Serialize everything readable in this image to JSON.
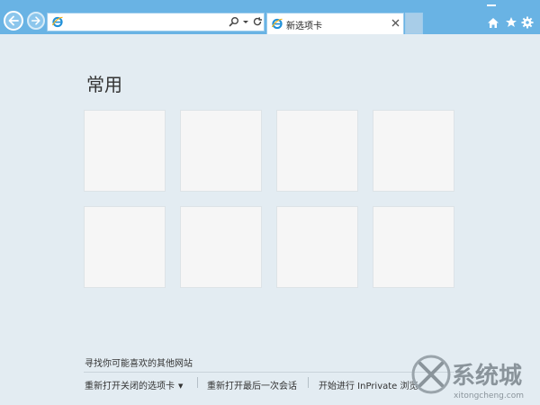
{
  "browser": {
    "address": {
      "value": "",
      "placeholder": ""
    },
    "tab": {
      "title": "新选项卡"
    }
  },
  "content": {
    "section_title": "常用",
    "tile_count": 8,
    "find_sites_link": "寻找你可能喜欢的其他网站",
    "bottom_links": {
      "reopen_closed_tabs": "重新打开关闭的选项卡",
      "reopen_last_session": "重新打开最后一次会话",
      "start_inprivate": "开始进行 InPrivate 浏览"
    }
  },
  "watermark": {
    "brand": "系统城",
    "domain": "xitongcheng.com"
  },
  "icons": [
    "back-arrow-icon",
    "forward-arrow-icon",
    "ie-logo-icon",
    "search-icon",
    "dropdown-arrow-icon",
    "refresh-icon",
    "close-icon",
    "home-icon",
    "star-icon",
    "gear-icon"
  ],
  "colors": {
    "titlebar": "#69b3e4",
    "background": "#e3ecf2",
    "tile": "#f6f6f6"
  }
}
